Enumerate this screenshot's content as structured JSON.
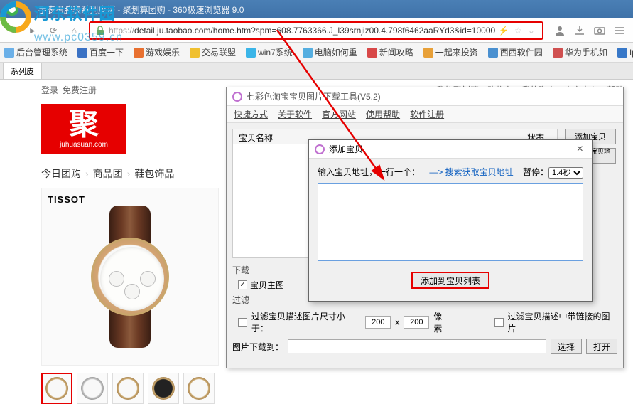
{
  "titlebar": {
    "text": "手表男腕表系列皮带 - 聚划算团购 - 360极速浏览器 9.0"
  },
  "toolbar": {
    "url_proto": "https://",
    "url_rest": "detail.ju.taobao.com/home.htm?spm=608.7763366.J_l39srnjiz00.4.798f6462aaRYd3&id=10000"
  },
  "bookmarks": [
    "后台管理系统",
    "百度一下",
    "游戏娱乐",
    "交易联盟",
    "win7系统",
    "电脑如何重",
    "新闻攻略",
    "一起来投资",
    "西西软件园",
    "华为手机如",
    "Iphone教"
  ],
  "tabs": {
    "active": "系列皮"
  },
  "page_topbar": {
    "login": "登录",
    "register": "免费注册",
    "right": [
      "我的聚划算",
      "购物车",
      "我的淘宝",
      "商家中心",
      "帮助"
    ]
  },
  "ju": {
    "char": "聚",
    "sub": "juhuasuan.com"
  },
  "breadcrumb": [
    "今日团购",
    "商品团",
    "鞋包饰品"
  ],
  "brand": "TISSOT",
  "tool": {
    "title": "七彩色淘宝宝贝图片下载工具(V5.2)",
    "tabs": [
      "快捷方式",
      "关于软件",
      "官方网站",
      "使用帮助",
      "软件注册"
    ],
    "grid": {
      "name": "宝贝名称",
      "status": "状态"
    },
    "side_btns": [
      "添加宝贝",
      "批量移除宝贝地址"
    ],
    "dl_label": "下载",
    "chk_main": "宝贝主图",
    "filter_label": "过滤",
    "filter1_pre": "过滤宝贝描述图片尺寸小于：",
    "filter_w": "200",
    "filter_h": "200",
    "filter1_suf": "像素",
    "filter2": "过滤宝贝描述中带链接的图片",
    "path_label": "图片下载到：",
    "btn_select": "选择",
    "btn_open": "打开"
  },
  "add_dialog": {
    "title": "添加宝贝",
    "input_label": "输入宝贝地址，一行一个：",
    "link": "—> 搜索获取宝贝地址",
    "pause_label": "暂停：",
    "pause_val": "1.4秒",
    "btn": "添加到宝贝列表"
  }
}
